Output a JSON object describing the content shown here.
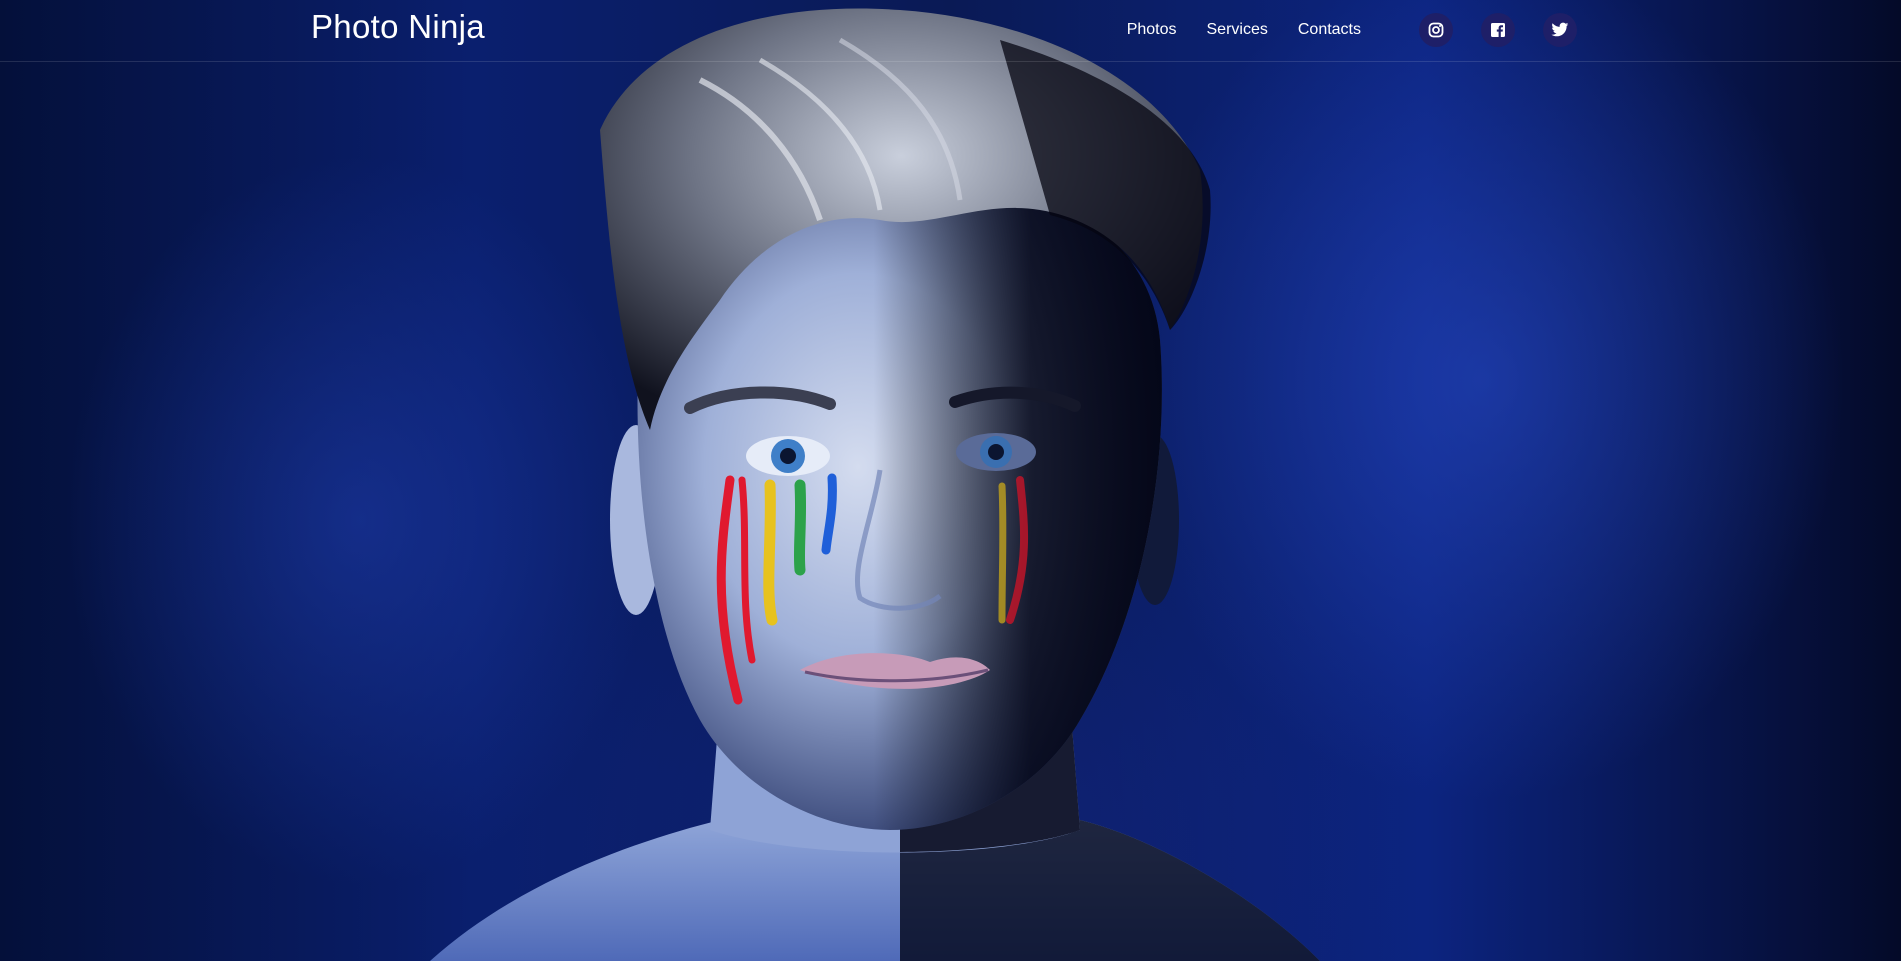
{
  "brand": {
    "name": "Photo Ninja"
  },
  "nav": {
    "items": [
      {
        "label": "Photos"
      },
      {
        "label": "Services"
      },
      {
        "label": "Contacts"
      }
    ],
    "social": [
      {
        "icon": "instagram-icon"
      },
      {
        "icon": "facebook-icon"
      },
      {
        "icon": "twitter-icon"
      }
    ]
  },
  "hero": {
    "photo": "portrait-with-rainbow-tears-icon"
  },
  "colors": {
    "background_dark": "#030a2a",
    "background_blue": "#0c2480",
    "social_bg": "#1e1f68",
    "text": "#ffffff"
  }
}
